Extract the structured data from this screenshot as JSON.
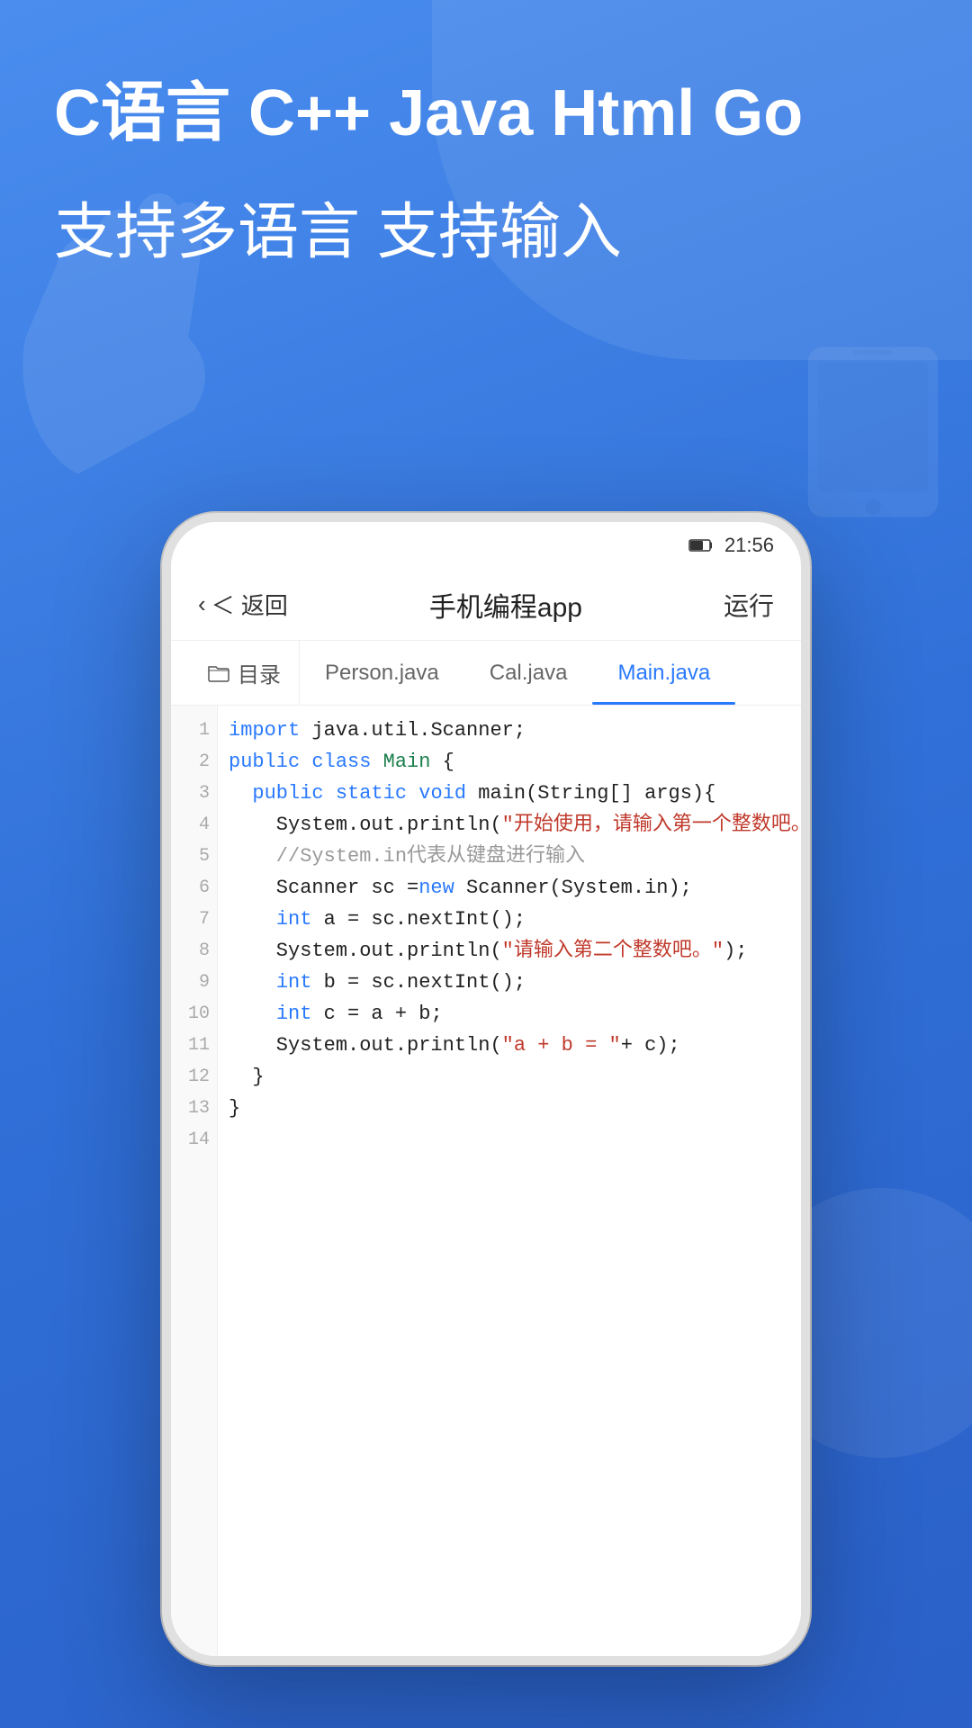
{
  "background": {
    "gradient_start": "#4a8def",
    "gradient_end": "#2a60c8"
  },
  "hero": {
    "title": "C语言 C++ Java Html Go",
    "subtitle": "支持多语言 支持输入"
  },
  "status_bar": {
    "battery": "27",
    "time": "21:56"
  },
  "app_header": {
    "back_label": "＜ 返回",
    "title": "手机编程app",
    "run_label": "运行"
  },
  "tabs": {
    "folder_label": "目录",
    "items": [
      {
        "label": "Person.java",
        "active": false
      },
      {
        "label": "Cal.java",
        "active": false
      },
      {
        "label": "Main.java",
        "active": true
      }
    ]
  },
  "code": {
    "lines": [
      {
        "num": 1,
        "content": "import java.util.Scanner;"
      },
      {
        "num": 2,
        "content": "public class Main {"
      },
      {
        "num": 3,
        "content": "  public static void main(String[] args){"
      },
      {
        "num": 4,
        "content": "    System.out.println(\"开始使用，请输入第一个整数吧。\");"
      },
      {
        "num": 5,
        "content": "    //System.in代表从键盘进行输入"
      },
      {
        "num": 6,
        "content": "    Scanner sc = new Scanner(System.in);"
      },
      {
        "num": 7,
        "content": "    int a = sc.nextInt();"
      },
      {
        "num": 8,
        "content": "    System.out.println(\"请输入第二个整数吧。\");"
      },
      {
        "num": 9,
        "content": "    int b = sc.nextInt();"
      },
      {
        "num": 10,
        "content": "    int c = a + b;"
      },
      {
        "num": 11,
        "content": "    System.out.println(\"a + b = \" + c);"
      },
      {
        "num": 12,
        "content": "  }"
      },
      {
        "num": 13,
        "content": "}"
      },
      {
        "num": 14,
        "content": ""
      }
    ]
  }
}
